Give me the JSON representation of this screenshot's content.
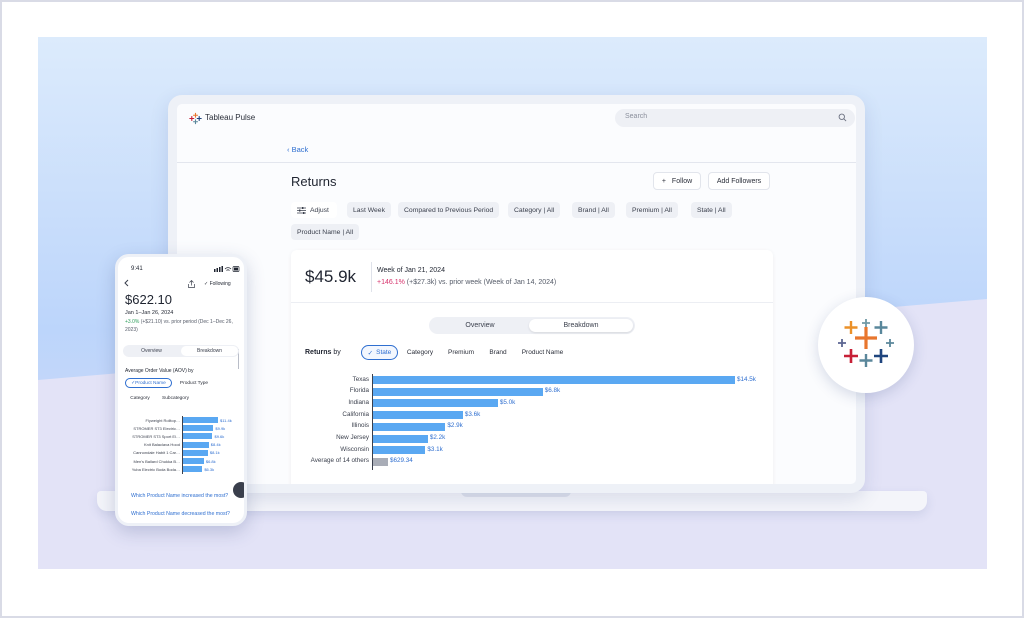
{
  "app": {
    "name": "Tableau Pulse",
    "search_placeholder": "Search",
    "back_label": "Back"
  },
  "metric": {
    "title": "Returns",
    "follow_label": "Follow",
    "add_followers_label": "Add Followers",
    "filters": {
      "adjust": "Adjust",
      "period": "Last Week",
      "comparison": "Compared to Previous Period",
      "category": "Category  |  All",
      "brand": "Brand  |  All",
      "premium": "Premium  |  All",
      "state": "State  |  All",
      "product_name": "Product Name  |  All"
    },
    "kpi": {
      "value": "$45.9k",
      "week": "Week of Jan 21, 2024",
      "change_pct": "+146.1%",
      "change_rest": " (+$27.3k) vs. prior week (Week of Jan 14, 2024)"
    },
    "tabs": {
      "overview": "Overview",
      "breakdown": "Breakdown"
    },
    "breakdown": {
      "by_prefix": "Returns",
      "by_word": "by",
      "dimensions": [
        "State",
        "Category",
        "Premium",
        "Brand",
        "Product Name"
      ]
    }
  },
  "chart_data": {
    "type": "bar",
    "orientation": "horizontal",
    "categories": [
      "Texas",
      "Florida",
      "Indiana",
      "California",
      "Illinois",
      "New Jersey",
      "Wisconsin",
      "Average of 14 others"
    ],
    "values": [
      14.5,
      6.8,
      5.0,
      3.6,
      2.9,
      2.2,
      2.1,
      0.62934
    ],
    "value_labels": [
      "$14.5k",
      "$6.8k",
      "$5.0k",
      "$3.6k",
      "$2.9k",
      "$2.2k",
      "$3.1k",
      "$629.34"
    ],
    "title": "",
    "xlabel": "",
    "ylabel": "",
    "colors": {
      "bar": "#5aa8f2",
      "others": "#a9adb7"
    }
  },
  "phone": {
    "time": "9:41",
    "following_label": "Following",
    "value": "$622.10",
    "date": "Jan 1–Jan 26, 2024",
    "change_pct": "+3.0%",
    "change_rest": " (+$21.10) vs. prior period (Dec 1–Dec 26, 2023)",
    "tabs": {
      "overview": "Overview",
      "breakdown": "Breakdown"
    },
    "metric_label": "Average Order Value (AOV) by",
    "dimensions": [
      "Product Name",
      "Product Type",
      "Category",
      "Subcategory"
    ],
    "bars": {
      "labels": [
        "Flyweight Rolltop…",
        "STROMER ST3 Electric…",
        "STROMER ST3 Sport El…",
        "Knit Balaclava Hood",
        "Cannondale Habit 1 Car…",
        "Men's Ballard Chukka B…",
        "Yuba Electric Boda Boda…"
      ],
      "values": [
        11.4,
        9.9,
        9.6,
        8.4,
        8.1,
        6.8,
        6.3
      ],
      "value_labels": [
        "$11.4k",
        "$9.9k",
        "$9.6k",
        "$8.4k",
        "$8.1k",
        "$6.8k",
        "$6.3k"
      ]
    },
    "question_1": "Which Product Name increased the most?",
    "question_2": "Which Product Name decreased the most?"
  },
  "colors": {
    "accent": "#2f6fd0",
    "bar": "#5aa8f2",
    "negative_change": "#d6336c",
    "positive_change": "#2e9e5b"
  }
}
